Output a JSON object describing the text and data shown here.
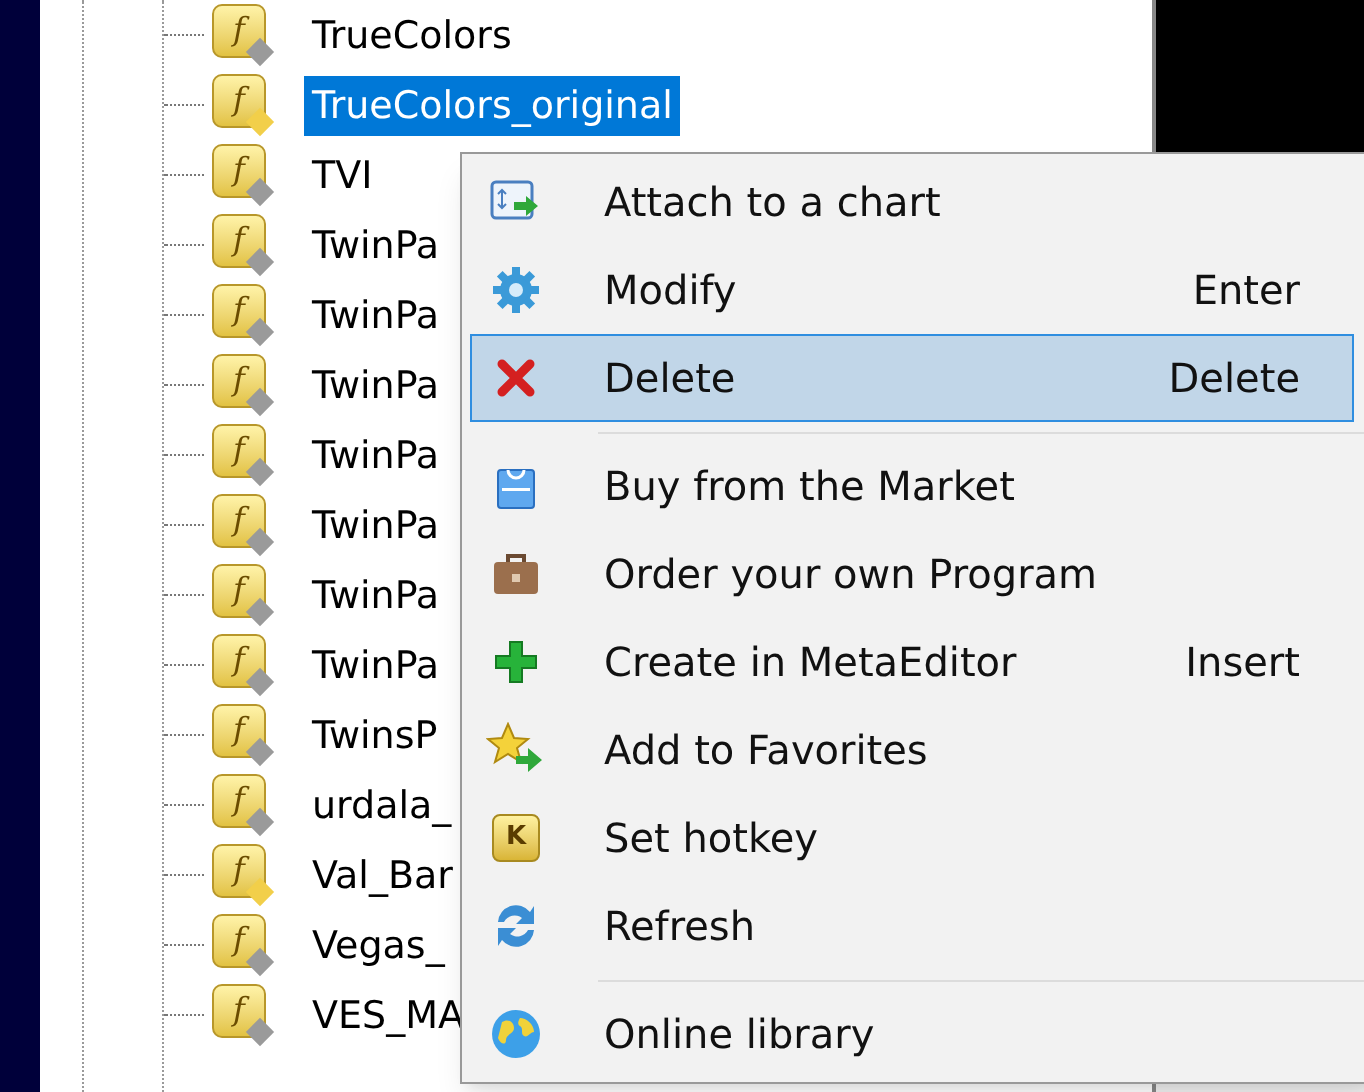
{
  "tree": {
    "items": [
      {
        "name": "TrueColors",
        "badge": "f",
        "color": "#9a9a9a",
        "selected": false
      },
      {
        "name": "TrueColors_original",
        "badge": "f",
        "color": "#f2cf4a",
        "selected": true
      },
      {
        "name": "TVI",
        "badge": "f",
        "color": "#9a9a9a",
        "selected": false
      },
      {
        "name": "TwinPa",
        "badge": "f",
        "color": "#9a9a9a",
        "selected": false
      },
      {
        "name": "TwinPa",
        "badge": "f",
        "color": "#9a9a9a",
        "selected": false
      },
      {
        "name": "TwinPa",
        "badge": "f",
        "color": "#9a9a9a",
        "selected": false
      },
      {
        "name": "TwinPa",
        "badge": "f",
        "color": "#9a9a9a",
        "selected": false
      },
      {
        "name": "TwinPa",
        "badge": "f",
        "color": "#9a9a9a",
        "selected": false
      },
      {
        "name": "TwinPa",
        "badge": "f",
        "color": "#9a9a9a",
        "selected": false
      },
      {
        "name": "TwinPa",
        "badge": "f",
        "color": "#9a9a9a",
        "selected": false
      },
      {
        "name": "TwinsP",
        "badge": "f",
        "color": "#9a9a9a",
        "selected": false
      },
      {
        "name": "urdala_",
        "badge": "f",
        "color": "#9a9a9a",
        "selected": false
      },
      {
        "name": "Val_Bar",
        "badge": "f",
        "color": "#f2cf4a",
        "selected": false
      },
      {
        "name": "Vegas_",
        "badge": "f",
        "color": "#9a9a9a",
        "selected": false
      },
      {
        "name": "VES_MA",
        "badge": "f",
        "color": "#9a9a9a",
        "selected": false
      }
    ]
  },
  "context_menu": {
    "items": [
      {
        "kind": "item",
        "label": "Attach to a chart",
        "selected": false
      },
      {
        "kind": "item",
        "label": "Modify",
        "shortcut": "Enter",
        "selected": false
      },
      {
        "kind": "item",
        "label": "Delete",
        "shortcut": "Delete",
        "selected": true
      },
      {
        "kind": "separator"
      },
      {
        "kind": "item",
        "label": "Buy from the Market",
        "selected": false
      },
      {
        "kind": "item",
        "label": "Order your own Program",
        "selected": false
      },
      {
        "kind": "item",
        "label": "Create in MetaEditor",
        "shortcut": "Insert",
        "selected": false
      },
      {
        "kind": "item",
        "label": "Add to Favorites",
        "selected": false
      },
      {
        "kind": "item",
        "label": "Set hotkey",
        "icon_letter": "K",
        "selected": false
      },
      {
        "kind": "item",
        "label": "Refresh",
        "selected": false
      },
      {
        "kind": "separator"
      },
      {
        "kind": "item",
        "label": "Online library",
        "selected": false
      }
    ]
  }
}
